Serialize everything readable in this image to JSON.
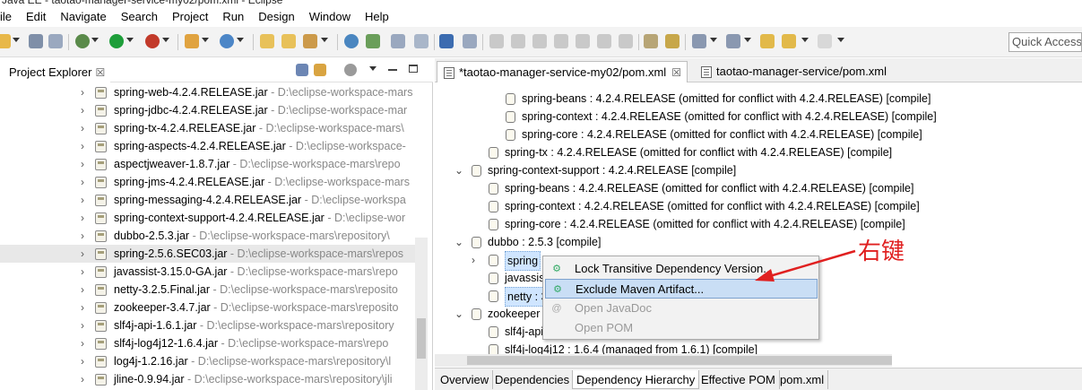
{
  "window": {
    "title": "Java EE - taotao-manager-service-my02/pom.xml - Eclipse"
  },
  "menu": [
    "ile",
    "Edit",
    "Navigate",
    "Search",
    "Project",
    "Run",
    "Design",
    "Window",
    "Help"
  ],
  "toolbar": {
    "quick_access": "Quick Access"
  },
  "project_explorer": {
    "tab_label": "Project Explorer",
    "close_glyph": "☒",
    "items": [
      {
        "name": "spring-web-4.2.4.RELEASE.jar",
        "path": " - D:\\eclipse-workspace-mars"
      },
      {
        "name": "spring-jdbc-4.2.4.RELEASE.jar",
        "path": " - D:\\eclipse-workspace-mar"
      },
      {
        "name": "spring-tx-4.2.4.RELEASE.jar",
        "path": " - D:\\eclipse-workspace-mars\\"
      },
      {
        "name": "spring-aspects-4.2.4.RELEASE.jar",
        "path": " - D:\\eclipse-workspace-"
      },
      {
        "name": "aspectjweaver-1.8.7.jar",
        "path": " - D:\\eclipse-workspace-mars\\repo"
      },
      {
        "name": "spring-jms-4.2.4.RELEASE.jar",
        "path": " - D:\\eclipse-workspace-mars"
      },
      {
        "name": "spring-messaging-4.2.4.RELEASE.jar",
        "path": " - D:\\eclipse-workspa"
      },
      {
        "name": "spring-context-support-4.2.4.RELEASE.jar",
        "path": " - D:\\eclipse-wor"
      },
      {
        "name": "dubbo-2.5.3.jar",
        "path": " - D:\\eclipse-workspace-mars\\repository\\"
      },
      {
        "name": "spring-2.5.6.SEC03.jar",
        "path": " - D:\\eclipse-workspace-mars\\repos",
        "selected": true
      },
      {
        "name": "javassist-3.15.0-GA.jar",
        "path": " - D:\\eclipse-workspace-mars\\repo"
      },
      {
        "name": "netty-3.2.5.Final.jar",
        "path": " - D:\\eclipse-workspace-mars\\reposito"
      },
      {
        "name": "zookeeper-3.4.7.jar",
        "path": " - D:\\eclipse-workspace-mars\\reposito"
      },
      {
        "name": "slf4j-api-1.6.1.jar",
        "path": " - D:\\eclipse-workspace-mars\\repository"
      },
      {
        "name": "slf4j-log4j12-1.6.4.jar",
        "path": " - D:\\eclipse-workspace-mars\\repo"
      },
      {
        "name": "log4j-1.2.16.jar",
        "path": " - D:\\eclipse-workspace-mars\\repository\\l"
      },
      {
        "name": "jline-0.9.94.jar",
        "path": " - D:\\eclipse-workspace-mars\\repository\\jli"
      }
    ]
  },
  "editor": {
    "tabs": [
      {
        "label": "*taotao-manager-service-my02/pom.xml",
        "close": "☒",
        "active": true
      },
      {
        "label": "taotao-manager-service/pom.xml",
        "active": false
      }
    ],
    "tree": [
      {
        "text": "spring-beans : 4.2.4.RELEASE (omitted for conflict with 4.2.4.RELEASE) [compile]",
        "indent": 2
      },
      {
        "text": "spring-context : 4.2.4.RELEASE (omitted for conflict with 4.2.4.RELEASE) [compile]",
        "indent": 2
      },
      {
        "text": "spring-core : 4.2.4.RELEASE (omitted for conflict with 4.2.4.RELEASE) [compile]",
        "indent": 2
      },
      {
        "text": "spring-tx : 4.2.4.RELEASE (omitted for conflict with 4.2.4.RELEASE) [compile]",
        "indent": 1
      },
      {
        "text": "spring-context-support : 4.2.4.RELEASE [compile]",
        "indent": 0,
        "twisty": "expanded"
      },
      {
        "text": "spring-beans : 4.2.4.RELEASE (omitted for conflict with 4.2.4.RELEASE) [compile]",
        "indent": 1
      },
      {
        "text": "spring-context : 4.2.4.RELEASE (omitted for conflict with 4.2.4.RELEASE) [compile]",
        "indent": 1
      },
      {
        "text": "spring-core : 4.2.4.RELEASE (omitted for conflict with 4.2.4.RELEASE) [compile]",
        "indent": 1
      },
      {
        "text": "dubbo : 2.5.3 [compile]",
        "indent": 0,
        "twisty": "expanded"
      },
      {
        "text": "spring",
        "indent": 1,
        "twisty": "collapsed",
        "highlight": true
      },
      {
        "text": "javassist",
        "indent": 1
      },
      {
        "text": "netty : 3",
        "indent": 1,
        "highlight": true
      },
      {
        "text": "zookeeper",
        "indent": 0,
        "twisty": "expanded"
      },
      {
        "text": "slf4j-api",
        "indent": 1
      },
      {
        "text": "slf4j-log4j12 : 1.6.4 (managed from 1.6.1) [compile]",
        "indent": 1
      }
    ],
    "bottom_tabs": [
      "Overview",
      "Dependencies",
      "Dependency Hierarchy",
      "Effective POM",
      "pom.xml"
    ]
  },
  "context_menu": {
    "items": [
      {
        "label": "Lock Transitive Dependency Version...",
        "enabled": true
      },
      {
        "label": "Exclude Maven Artifact...",
        "enabled": true,
        "hover": true
      },
      {
        "label": "Open JavaDoc",
        "enabled": false
      },
      {
        "label": "Open POM",
        "enabled": false
      }
    ]
  },
  "annotation": {
    "text": "右键",
    "color": "#e02020"
  }
}
